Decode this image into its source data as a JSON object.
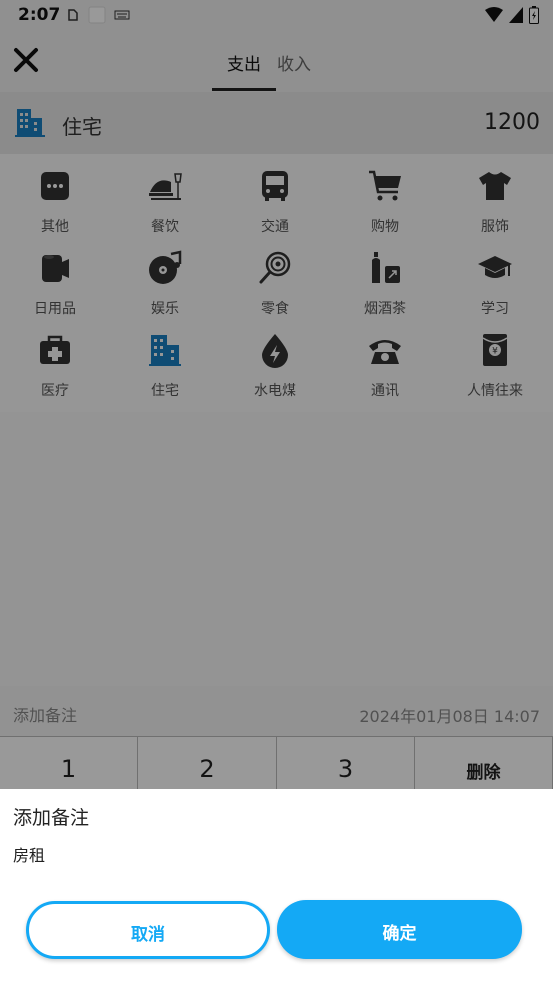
{
  "status_bar": {
    "time": "2:07"
  },
  "header": {
    "tabs": [
      {
        "label": "支出",
        "active": true
      },
      {
        "label": "收入",
        "active": false
      }
    ]
  },
  "selected": {
    "category": "住宅",
    "amount": "1200",
    "icon": "building-icon"
  },
  "categories": [
    {
      "label": "其他",
      "icon": "more-icon"
    },
    {
      "label": "餐饮",
      "icon": "dining-icon"
    },
    {
      "label": "交通",
      "icon": "bus-icon"
    },
    {
      "label": "购物",
      "icon": "cart-icon"
    },
    {
      "label": "服饰",
      "icon": "tshirt-icon"
    },
    {
      "label": "日用品",
      "icon": "tissue-icon"
    },
    {
      "label": "娱乐",
      "icon": "music-icon"
    },
    {
      "label": "零食",
      "icon": "lollipop-icon"
    },
    {
      "label": "烟酒茶",
      "icon": "bottle-icon"
    },
    {
      "label": "学习",
      "icon": "graduation-cap-icon"
    },
    {
      "label": "医疗",
      "icon": "medical-kit-icon"
    },
    {
      "label": "住宅",
      "icon": "building-icon",
      "selected": true
    },
    {
      "label": "水电煤",
      "icon": "energy-drop-icon"
    },
    {
      "label": "通讯",
      "icon": "phone-icon"
    },
    {
      "label": "人情往来",
      "icon": "red-envelope-icon"
    }
  ],
  "note_row": {
    "label": "添加备注",
    "datetime": "2024年01月08日 14:07"
  },
  "keypad": {
    "keys": [
      "1",
      "2",
      "3",
      "删除"
    ]
  },
  "dialog": {
    "title": "添加备注",
    "input_value": "房租",
    "cancel_label": "取消",
    "confirm_label": "确定"
  },
  "colors": {
    "accent": "#14a9f5",
    "selected_icon": "#1a7fc1",
    "icon": "#333333"
  }
}
